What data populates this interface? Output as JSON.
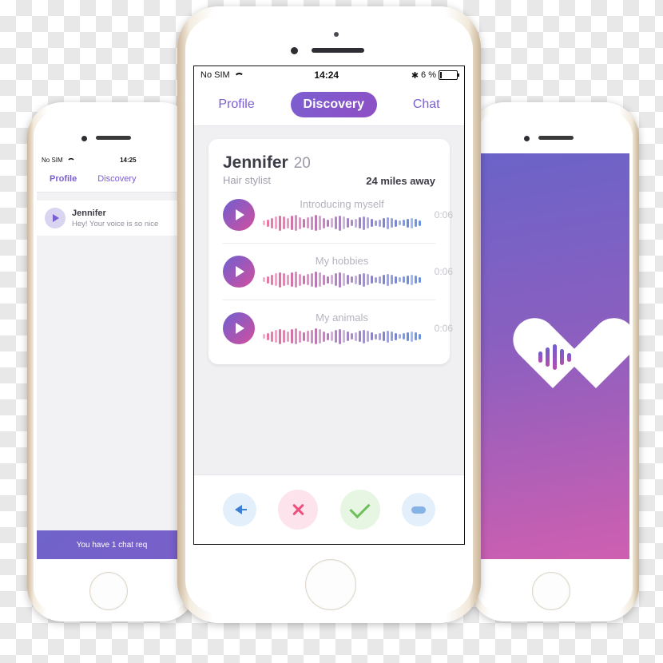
{
  "center_phone": {
    "status_bar": {
      "carrier": "No SIM",
      "wifi_icon": "wifi-icon",
      "time": "14:24",
      "bluetooth_icon": "bluetooth-icon",
      "battery_text": "6 %",
      "battery_icon": "battery-icon"
    },
    "tabs": [
      {
        "label": "Profile",
        "active": false
      },
      {
        "label": "Discovery",
        "active": true
      },
      {
        "label": "Chat",
        "active": false
      }
    ],
    "profile": {
      "name": "Jennifer",
      "age": "20",
      "job": "Hair stylist",
      "distance": "24 miles away",
      "tracks": [
        {
          "title": "Introducing myself",
          "duration": "0:06",
          "play_icon": "play-icon"
        },
        {
          "title": "My hobbies",
          "duration": "0:06",
          "play_icon": "play-icon"
        },
        {
          "title": "My animals",
          "duration": "0:06",
          "play_icon": "play-icon"
        }
      ]
    },
    "actions": [
      {
        "name": "rewind-button",
        "icon": "arrow-left-icon",
        "color": "#3d7fd6"
      },
      {
        "name": "reject-button",
        "icon": "x-icon",
        "color": "#ef4f7e"
      },
      {
        "name": "accept-button",
        "icon": "check-icon",
        "color": "#6dbf5b"
      },
      {
        "name": "more-button",
        "icon": "pill-icon",
        "color": "#3d7fd6"
      }
    ]
  },
  "left_phone": {
    "status_bar": {
      "carrier": "No SIM",
      "wifi_icon": "wifi-icon",
      "time": "14:25"
    },
    "tabs": [
      {
        "label": "Profile",
        "active": true
      },
      {
        "label": "Discovery",
        "active": false
      }
    ],
    "chat_row": {
      "name": "Jennifer",
      "message": "Hey! Your voice is so nice",
      "play_icon": "play-icon"
    },
    "banner": "You have 1 chat req"
  },
  "right_phone": {
    "logo_icon": "heart-with-soundwave-icon",
    "gradient_from": "#6b63c8",
    "gradient_to": "#cf5fb0"
  },
  "theme": {
    "accent_purple": "#7b5fd1",
    "accent_pink": "#d24f9e",
    "muted_text": "#b4b4be"
  }
}
